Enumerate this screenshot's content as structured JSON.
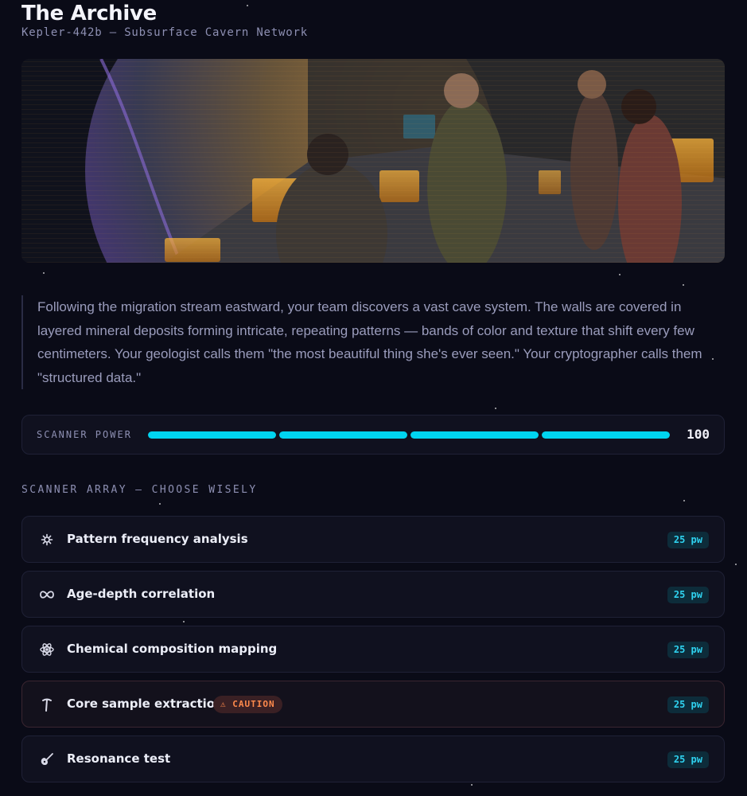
{
  "header": {
    "title": "The Archive",
    "subtitle": "Kepler-442b — Subsurface Cavern Network"
  },
  "hero": {
    "description": "Crew members at glowing amber console stations aboard a spacecraft, a planet visible through the window"
  },
  "story": {
    "text": "Following the migration stream eastward, your team discovers a vast cave system. The walls are covered in layered mineral deposits forming intricate, repeating patterns — bands of color and texture that shift every few centimeters. Your geologist calls them \"the most beautiful thing she's ever seen.\" Your cryptographer calls them \"structured data.\""
  },
  "scanner_power": {
    "label": "SCANNER POWER",
    "value": "100",
    "segments": [
      1,
      1,
      1,
      1
    ],
    "color": "#00d4f0"
  },
  "scanner_array": {
    "title": "SCANNER ARRAY — CHOOSE WISELY",
    "options": [
      {
        "icon": "sparkle-gear-icon",
        "label": "Pattern frequency analysis",
        "cost": "25 pw",
        "caution": ""
      },
      {
        "icon": "infinity-icon",
        "label": "Age-depth correlation",
        "cost": "25 pw",
        "caution": ""
      },
      {
        "icon": "atom-icon",
        "label": "Chemical composition mapping",
        "cost": "25 pw",
        "caution": ""
      },
      {
        "icon": "pickaxe-icon",
        "label": "Core sample extraction",
        "cost": "25 pw",
        "caution": "⚠ CAUTION"
      },
      {
        "icon": "guitar-icon",
        "label": "Resonance test",
        "cost": "25 pw",
        "caution": ""
      }
    ]
  },
  "colors": {
    "background": "#0a0b17",
    "accent": "#00d4f0",
    "caution": "#ff8a4c"
  }
}
